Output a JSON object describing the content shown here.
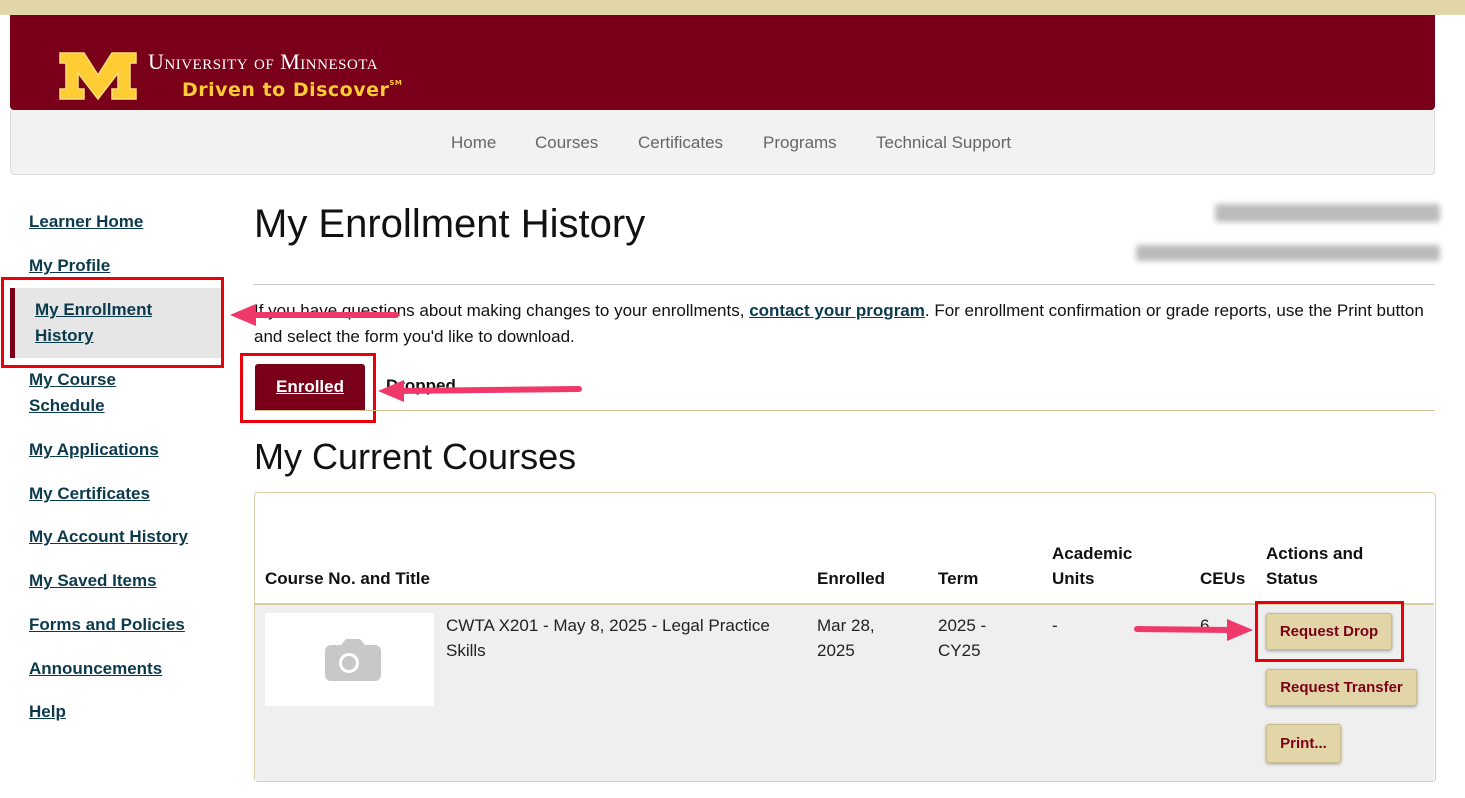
{
  "header": {
    "university_name": "University of Minnesota",
    "tagline": "Driven to Discover",
    "tagline_mark": "SM"
  },
  "nav": {
    "items": [
      {
        "label": "Home"
      },
      {
        "label": "Courses"
      },
      {
        "label": "Certificates"
      },
      {
        "label": "Programs"
      },
      {
        "label": "Technical Support"
      }
    ]
  },
  "sidebar": {
    "items": [
      {
        "label": "Learner Home"
      },
      {
        "label": "My Profile"
      },
      {
        "label": "My Enrollment History",
        "active": true
      },
      {
        "label": "My Course Schedule"
      },
      {
        "label": "My Applications"
      },
      {
        "label": "My Certificates"
      },
      {
        "label": "My Account History"
      },
      {
        "label": "My Saved Items"
      },
      {
        "label": "Forms and Policies"
      },
      {
        "label": "Announcements"
      },
      {
        "label": "Help"
      }
    ]
  },
  "main": {
    "title": "My Enrollment History",
    "intro_before": "If you have questions about making changes to your enrollments, ",
    "intro_link": "contact your program",
    "intro_after": ". For enrollment confirmation or grade reports, use the Print button and select the form you'd like to download.",
    "tabs": [
      {
        "label": "Enrolled",
        "active": true
      },
      {
        "label": "Dropped"
      }
    ],
    "section_title": "My Current Courses"
  },
  "table": {
    "headers": {
      "course": "Course No. and Title",
      "enrolled": "Enrolled",
      "term": "Term",
      "units_line1": "Academic",
      "units_line2": "Units",
      "ceus": "CEUs",
      "actions_line1": "Actions and",
      "actions_line2": "Status"
    },
    "rows": [
      {
        "title_line1": "CWTA X201 - May 8, 2025 - Legal Practice",
        "title_line2": "Skills",
        "enrolled_line1": "Mar 28,",
        "enrolled_line2": "2025",
        "term_line1": "2025 -",
        "term_line2": "CY25",
        "units": "-",
        "ceus": "6",
        "actions": {
          "drop": "Request Drop",
          "transfer": "Request Transfer",
          "print": "Print..."
        }
      }
    ]
  },
  "colors": {
    "maroon": "#7a0019",
    "gold": "#ffcc33",
    "button_bg": "#e2d6a9",
    "annotation_red": "#e8000b",
    "annotation_arrow": "#f0386b"
  }
}
